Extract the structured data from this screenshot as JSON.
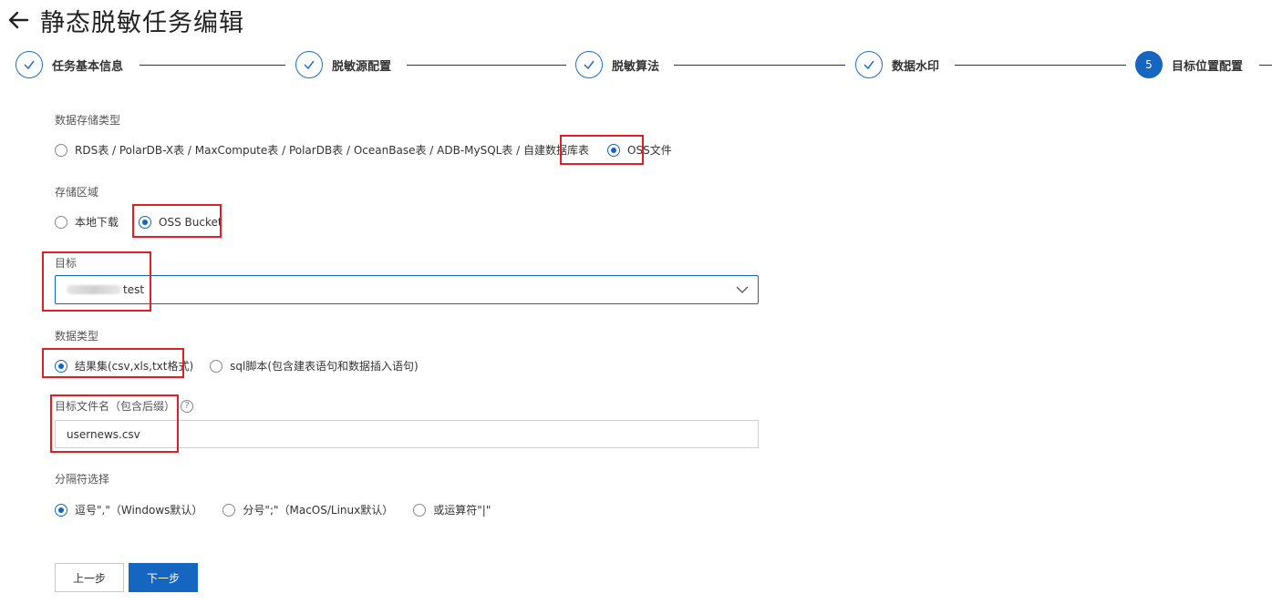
{
  "header": {
    "title": "静态脱敏任务编辑"
  },
  "steps": [
    {
      "label": "任务基本信息",
      "status": "done"
    },
    {
      "label": "脱敏源配置",
      "status": "done"
    },
    {
      "label": "脱敏算法",
      "status": "done"
    },
    {
      "label": "数据水印",
      "status": "done"
    },
    {
      "label": "目标位置配置",
      "status": "active",
      "number": "5"
    }
  ],
  "storage_type": {
    "label": "数据存储类型",
    "options": [
      {
        "label": "RDS表 / PolarDB-X表 / MaxCompute表 / PolarDB表 / OceanBase表 / ADB-MySQL表 / 自建数据库表",
        "checked": false
      },
      {
        "label": "OSS文件",
        "checked": true
      }
    ]
  },
  "storage_area": {
    "label": "存储区域",
    "options": [
      {
        "label": "本地下载",
        "checked": false
      },
      {
        "label": "OSS Bucket",
        "checked": true
      }
    ]
  },
  "target": {
    "label": "目标",
    "value_suffix": "test"
  },
  "data_type": {
    "label": "数据类型",
    "options": [
      {
        "label": "结果集(csv,xls,txt格式)",
        "checked": true
      },
      {
        "label": "sql脚本(包含建表语句和数据插入语句)",
        "checked": false
      }
    ]
  },
  "filename": {
    "label": "目标文件名（包含后缀）",
    "help": "?",
    "value": "usernews.csv"
  },
  "delimiter": {
    "label": "分隔符选择",
    "options": [
      {
        "label": "逗号\",\"（Windows默认）",
        "checked": true
      },
      {
        "label": "分号\";\"（MacOS/Linux默认）",
        "checked": false
      },
      {
        "label": "或运算符\"|\"",
        "checked": false
      }
    ]
  },
  "buttons": {
    "prev": "上一步",
    "next": "下一步"
  },
  "colors": {
    "primary": "#1566c0",
    "highlight": "#e02020"
  }
}
